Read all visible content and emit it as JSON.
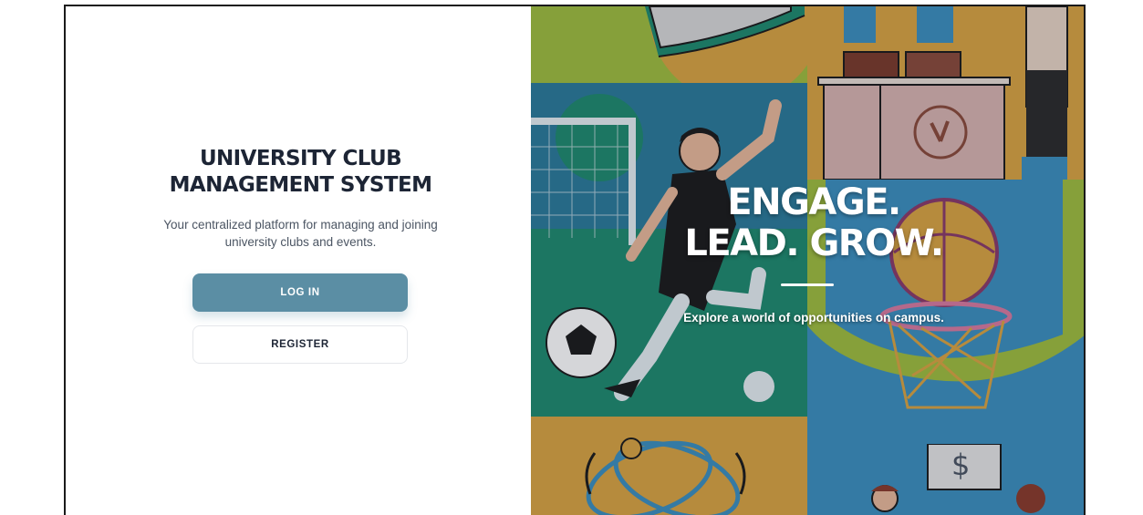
{
  "app": {
    "title_line1": "UNIVERSITY CLUB",
    "title_line2": "MANAGEMENT SYSTEM",
    "subtitle_line1": "Your centralized platform for managing and joining",
    "subtitle_line2": "university clubs and events."
  },
  "actions": {
    "login_label": "LOG IN",
    "register_label": "REGISTER"
  },
  "hero": {
    "headline_line1": "ENGAGE.",
    "headline_line2": "LEAD. GROW.",
    "tagline": "Explore a world of opportunities on campus."
  },
  "illustration": {
    "price_sign": "$"
  },
  "colors": {
    "primary": "#5b8ea4",
    "title": "#1d2535",
    "subtitle": "#4b5563",
    "tile_green": "#9fbe3e",
    "tile_blue": "#3b8fbf",
    "tile_gold": "#d9a441",
    "tile_teal": "#2a7a9a"
  }
}
